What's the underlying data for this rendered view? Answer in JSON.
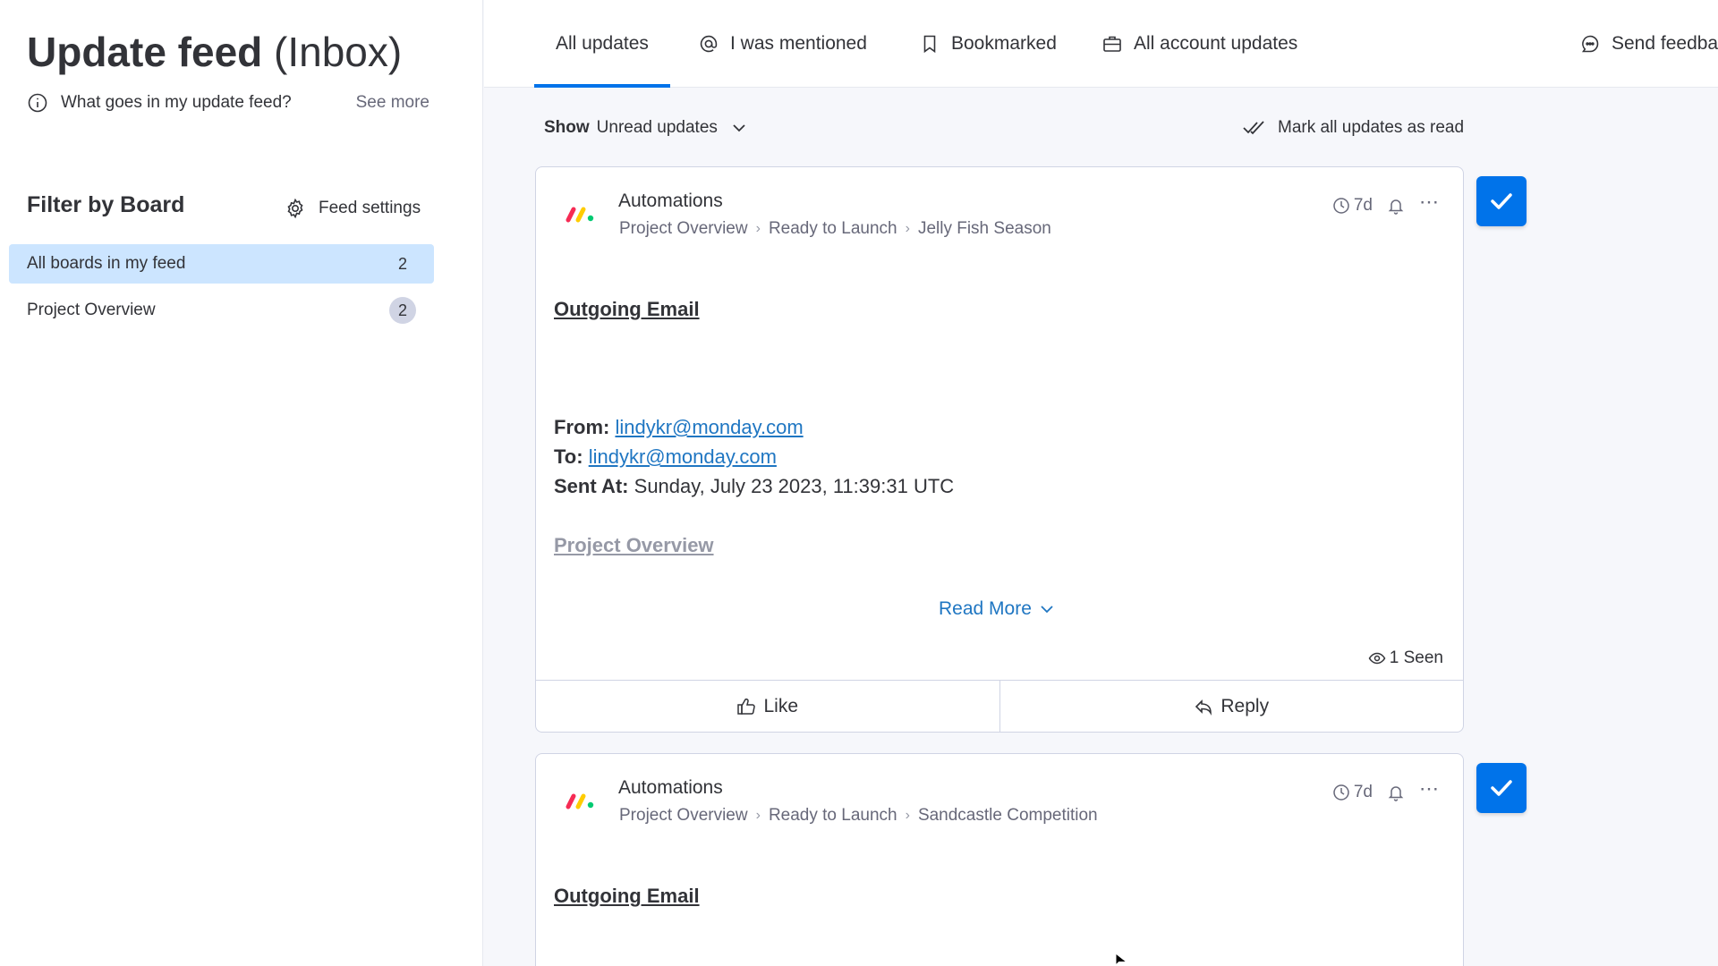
{
  "sidebar": {
    "title_main": "Update feed",
    "title_sub": "(Inbox)",
    "info_text": "What goes in my update feed?",
    "see_more": "See more",
    "filter_title": "Filter by Board",
    "feed_settings": "Feed settings",
    "boards": [
      {
        "label": "All boards in my feed",
        "count": "2",
        "active": true
      },
      {
        "label": "Project Overview",
        "count": "2",
        "active": false
      }
    ]
  },
  "tabs": {
    "all_updates": "All updates",
    "mentioned": "I was mentioned",
    "bookmarked": "Bookmarked",
    "account_updates": "All account updates",
    "send_feedback": "Send feedba"
  },
  "controls": {
    "show_label": "Show",
    "show_value": "Unread updates",
    "mark_all": "Mark all updates as read"
  },
  "updates": [
    {
      "author": "Automations",
      "crumbs": [
        "Project Overview",
        "Ready to Launch",
        "Jelly Fish Season"
      ],
      "time": "7d",
      "email_title": "Outgoing Email",
      "from_label": "From:",
      "from_value": "lindykr@monday.com",
      "to_label": "To:",
      "to_value": "lindykr@monday.com",
      "sent_label": "Sent At:",
      "sent_value": "Sunday, July 23 2023, 11:39:31 UTC",
      "project_link": "Project Overview",
      "read_more": "Read More",
      "seen": "1 Seen",
      "like": "Like",
      "reply": "Reply"
    },
    {
      "author": "Automations",
      "crumbs": [
        "Project Overview",
        "Ready to Launch",
        "Sandcastle Competition"
      ],
      "time": "7d",
      "email_title": "Outgoing Email"
    }
  ],
  "colors": {
    "accent": "#0073ea",
    "active_filter": "#cce5ff",
    "link": "#1f76c2"
  }
}
